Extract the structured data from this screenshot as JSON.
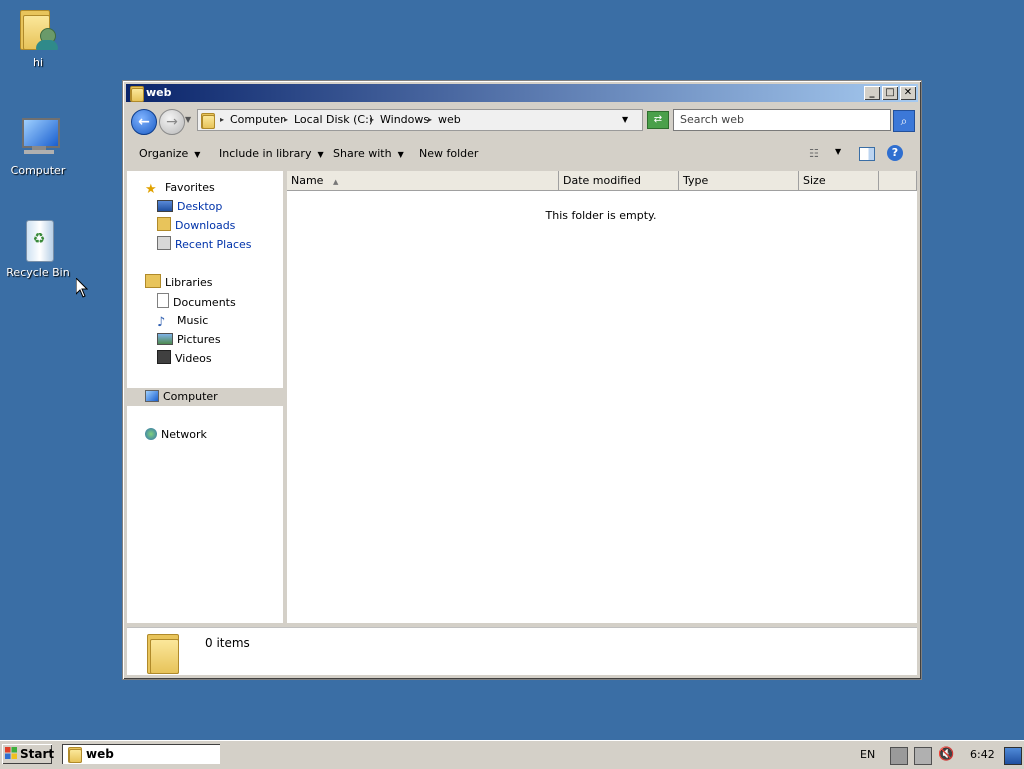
{
  "desktop": {
    "icons": [
      {
        "label": "hi"
      },
      {
        "label": "Computer"
      },
      {
        "label": "Recycle Bin"
      }
    ]
  },
  "window": {
    "title": "web",
    "controls": {
      "minimize": "_",
      "maximize": "□",
      "close": "✕"
    },
    "address": {
      "crumbs": [
        "Computer",
        "Local Disk (C:)",
        "Windows",
        "web"
      ],
      "separator": "▸"
    },
    "search": {
      "placeholder": "Search web"
    },
    "toolbar": {
      "organize": "Organize",
      "include_in_library": "Include in library",
      "share_with": "Share with",
      "new_folder": "New folder"
    },
    "navpane": {
      "favorites": "Favorites",
      "favorites_items": [
        "Desktop",
        "Downloads",
        "Recent Places"
      ],
      "libraries": "Libraries",
      "libraries_items": [
        "Documents",
        "Music",
        "Pictures",
        "Videos"
      ],
      "computer": "Computer",
      "network": "Network"
    },
    "columns": [
      "Name",
      "Date modified",
      "Type",
      "Size"
    ],
    "empty_message": "This folder is empty.",
    "details": {
      "count": "0 items"
    }
  },
  "taskbar": {
    "start": "Start",
    "task": "web",
    "language": "EN",
    "clock": "6:42"
  },
  "colors": {
    "desktop": "#3a6ea5",
    "titlebar": "#0a246a"
  }
}
